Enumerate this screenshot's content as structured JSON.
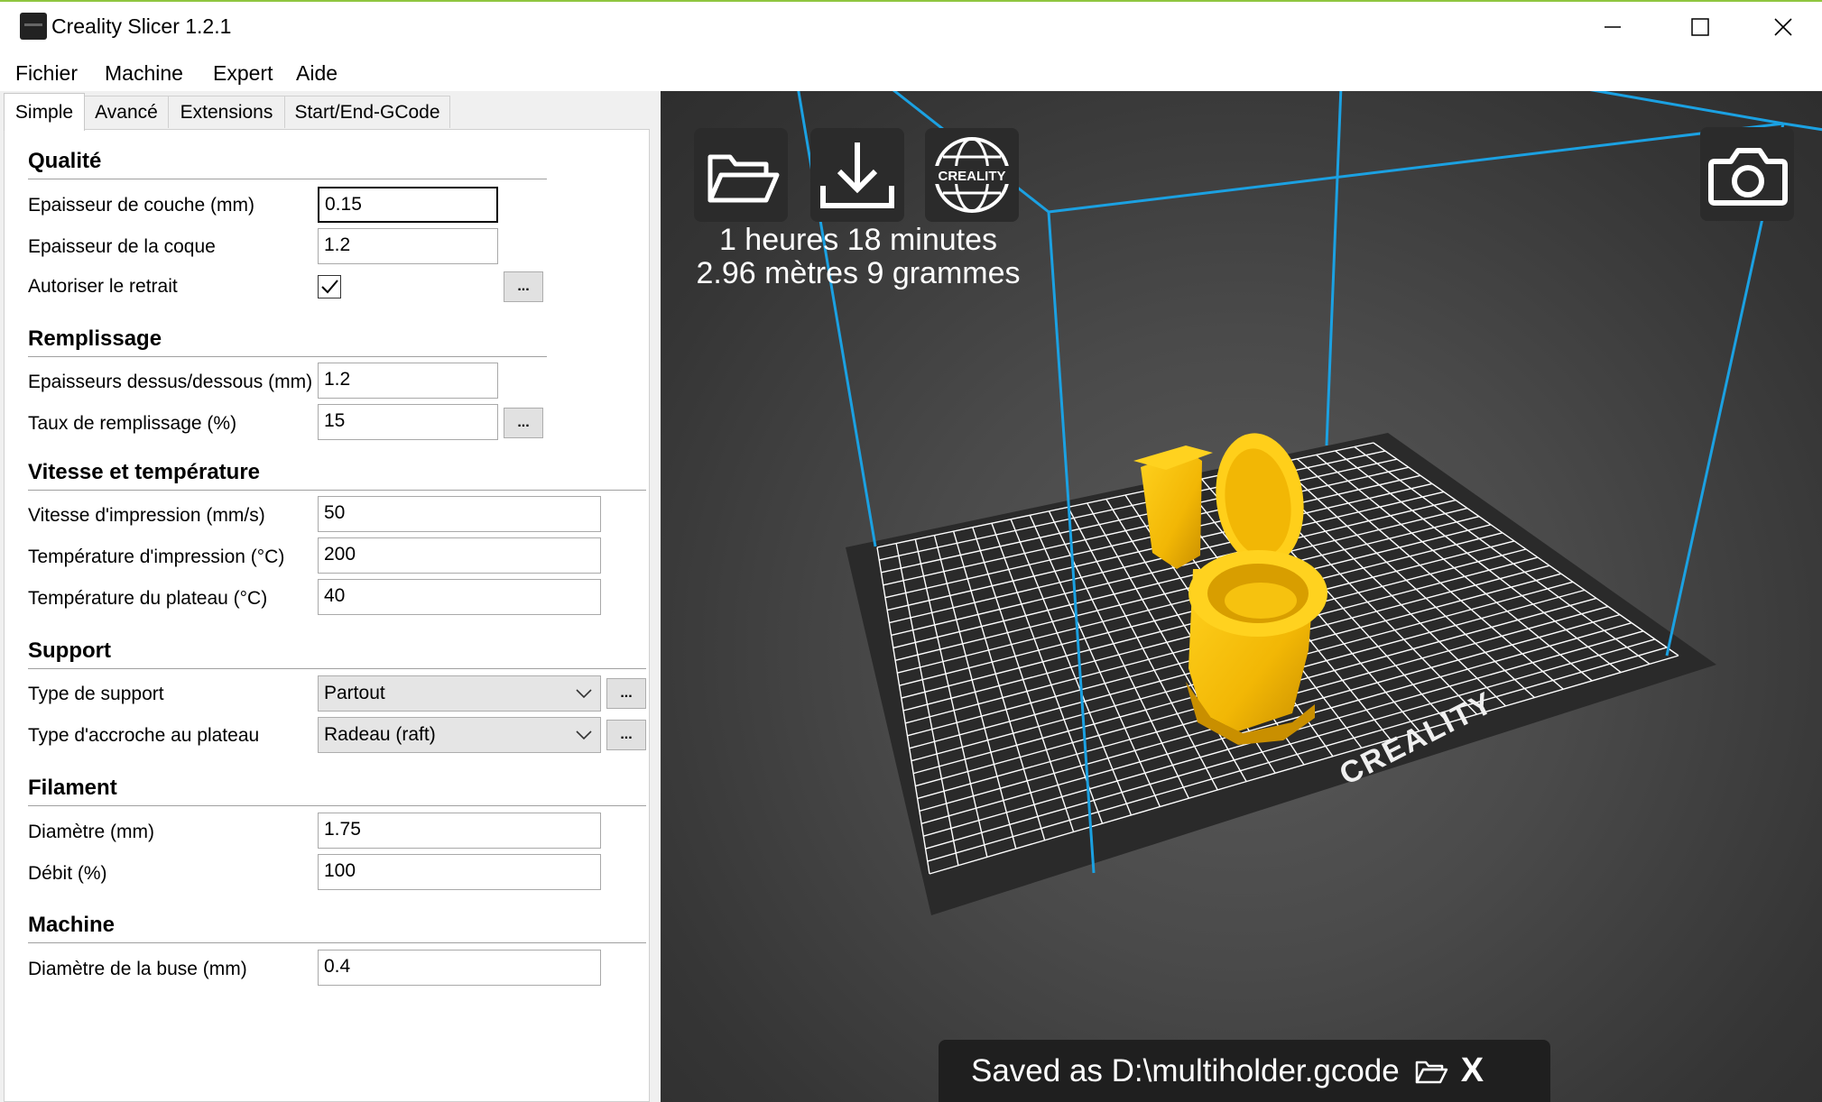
{
  "window": {
    "title": "Creality Slicer 1.2.1",
    "minimize_icon": "minimize-icon",
    "maximize_icon": "maximize-icon",
    "close_icon": "close-icon"
  },
  "menu": [
    "Fichier",
    "Machine",
    "Expert",
    "Aide"
  ],
  "tabs": [
    "Simple",
    "Avancé",
    "Extensions",
    "Start/End-GCode"
  ],
  "active_tab": "Simple",
  "sections": {
    "qualite": {
      "title": "Qualité",
      "layer_label": "Epaisseur de couche (mm)",
      "layer_value": "0.15",
      "shell_label": "Epaisseur de la coque",
      "shell_value": "1.2",
      "retract_label": "Autoriser le retrait",
      "retract_checked": true
    },
    "remplissage": {
      "title": "Remplissage",
      "topbottom_label": "Epaisseurs dessus/dessous (mm)",
      "topbottom_value": "1.2",
      "fill_label": "Taux de remplissage (%)",
      "fill_value": "15"
    },
    "vitesse": {
      "title": "Vitesse et température",
      "speed_label": "Vitesse d'impression (mm/s)",
      "speed_value": "50",
      "temp_label": "Température d'impression (°C)",
      "temp_value": "200",
      "bed_label": "Température du plateau (°C)",
      "bed_value": "40"
    },
    "support": {
      "title": "Support",
      "type_label": "Type de support",
      "type_value": "Partout",
      "adhesion_label": "Type d'accroche au plateau",
      "adhesion_value": "Radeau (raft)"
    },
    "filament": {
      "title": "Filament",
      "diameter_label": "Diamètre (mm)",
      "diameter_value": "1.75",
      "flow_label": "Débit (%)",
      "flow_value": "100"
    },
    "machine": {
      "title": "Machine",
      "nozzle_label": "Diamètre de la buse (mm)",
      "nozzle_value": "0.4"
    }
  },
  "dots_label": "...",
  "viewport": {
    "print_time": "1 heures 18 minutes",
    "print_material": "2.96 mètres 9 grammes",
    "saved_message": "Saved as D:\\multiholder.gcode",
    "saved_close": "X",
    "bed_logo": "CREALITY",
    "web_logo": "CREALITY",
    "colors": {
      "bed_lines": "#ffffff",
      "build_volume": "#1ba1e2",
      "model": "#f2b705"
    }
  }
}
